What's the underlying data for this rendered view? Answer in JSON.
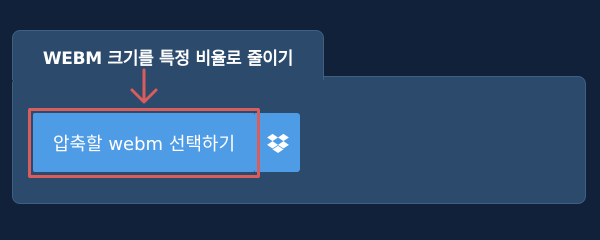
{
  "tab": {
    "title": "WEBM 크기를 특정 비율로 줄이기"
  },
  "upload": {
    "button_label": "압축할 webm 선택하기",
    "dropbox_icon": "dropbox-icon"
  },
  "colors": {
    "background": "#12213a",
    "panel": "#2c4a6c",
    "button": "#4e9be6",
    "highlight": "#d95d5d"
  }
}
